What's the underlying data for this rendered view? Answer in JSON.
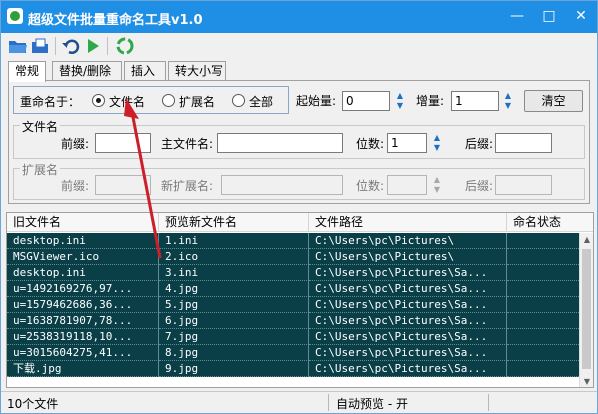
{
  "window": {
    "title": "超级文件批量重命名工具v1.0"
  },
  "toolbar": {
    "icons": [
      "open-folder-icon",
      "open-files-icon",
      "undo-icon",
      "run-icon",
      "recycle-icon"
    ],
    "accent": "#1f8fe6"
  },
  "tabs": [
    {
      "label": "常规",
      "active": true
    },
    {
      "label": "替换/删除",
      "active": false
    },
    {
      "label": "插入",
      "active": false
    },
    {
      "label": "转大小写",
      "active": false
    }
  ],
  "rename_target": {
    "label": "重命名于：",
    "options": [
      {
        "label": "文件名",
        "selected": true
      },
      {
        "label": "扩展名",
        "selected": false
      },
      {
        "label": "全部",
        "selected": false
      }
    ]
  },
  "start": {
    "label": "起始量:",
    "value": "0"
  },
  "increment": {
    "label": "增量:",
    "value": "1"
  },
  "clear_button": "清空",
  "filename_group": {
    "title": "文件名",
    "prefix_label": "前缀:",
    "prefix_value": "",
    "main_label": "主文件名:",
    "main_value": "",
    "digits_label": "位数:",
    "digits_value": "1",
    "suffix_label": "后缀:",
    "suffix_value": ""
  },
  "ext_group": {
    "title": "扩展名",
    "prefix_label": "前缀:",
    "new_ext_label": "新扩展名:",
    "digits_label": "位数:",
    "suffix_label": "后缀:"
  },
  "table": {
    "columns": [
      "旧文件名",
      "预览新文件名",
      "文件路径",
      "命名状态"
    ],
    "row_color": "#0a3f48",
    "rows": [
      [
        "desktop.ini",
        "1.ini",
        "C:\\Users\\pc\\Pictures\\",
        ""
      ],
      [
        "MSGViewer.ico",
        "2.ico",
        "C:\\Users\\pc\\Pictures\\",
        ""
      ],
      [
        "desktop.ini",
        "3.ini",
        "C:\\Users\\pc\\Pictures\\Sa...",
        ""
      ],
      [
        "u=1492169276,97...",
        "4.jpg",
        "C:\\Users\\pc\\Pictures\\Sa...",
        ""
      ],
      [
        "u=1579462686,36...",
        "5.jpg",
        "C:\\Users\\pc\\Pictures\\Sa...",
        ""
      ],
      [
        "u=1638781907,78...",
        "6.jpg",
        "C:\\Users\\pc\\Pictures\\Sa...",
        ""
      ],
      [
        "u=2538319118,10...",
        "7.jpg",
        "C:\\Users\\pc\\Pictures\\Sa...",
        ""
      ],
      [
        "u=3015604275,41...",
        "8.jpg",
        "C:\\Users\\pc\\Pictures\\Sa...",
        ""
      ],
      [
        "下载.jpg",
        "9.jpg",
        "C:\\Users\\pc\\Pictures\\Sa...",
        ""
      ]
    ]
  },
  "status": {
    "file_count": "10个文件",
    "auto_preview": "自动预览 - 开"
  },
  "annotation": {
    "arrow_color": "#cc1f2a"
  }
}
